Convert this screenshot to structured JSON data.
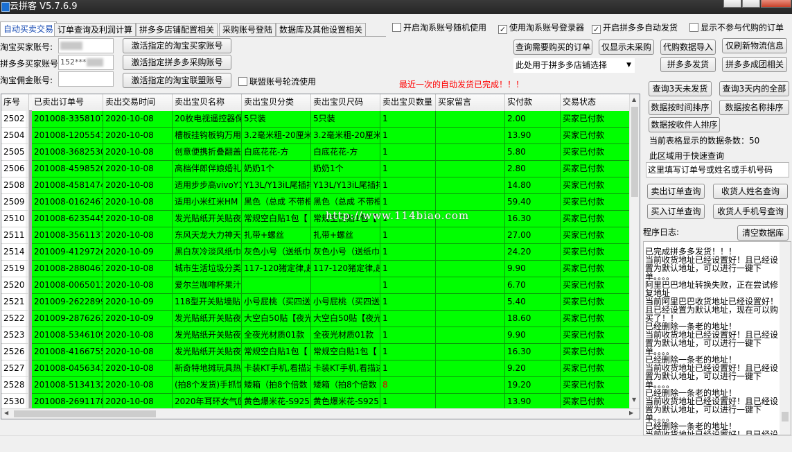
{
  "window": {
    "title": "云拼客 V5.7.6.9"
  },
  "tabs": [
    {
      "label": "自动买卖交易",
      "active": true
    },
    {
      "label": "订单查询及利润计算"
    },
    {
      "label": "拼多多店铺配置相关"
    },
    {
      "label": "采购账号登陆"
    },
    {
      "label": "数据库及其他设置相关"
    }
  ],
  "top_checkboxes": [
    {
      "label": "开启淘系账号随机使用",
      "checked": false
    },
    {
      "label": "使用淘系账号登录器",
      "checked": true
    },
    {
      "label": "开启拼多多自动发货",
      "checked": true
    },
    {
      "label": "显示不参与代购的订单",
      "checked": false
    }
  ],
  "accounts": {
    "taobao_buyer_label": "淘宝买家账号:",
    "pdd_buyer_label": "拼多多买家账号:",
    "taobao_commission_label": "淘宝佣金账号:",
    "pdd_buyer_value": "152***",
    "activate_taobao": "激活指定的淘宝买家账号",
    "activate_pdd": "激活指定拼多多采购账号",
    "activate_alliance": "激活指定的淘宝联盟账号",
    "alliance_rotate": "联盟账号轮流使用"
  },
  "actions": {
    "query_to_buy": "查询需要购买的订单",
    "only_not_bought": "仅显示未采购",
    "import_proxy": "代购数据导入",
    "refresh_logistics": "仅刷新物流信息",
    "store_select": "此处用于拼多多店铺选择",
    "pdd_ship": "拼多多发货",
    "pdd_group": "拼多多成团相关",
    "last_status": "最近一次的自动发货已完成！！！"
  },
  "grid": {
    "columns": [
      "序号",
      "已卖出订单号",
      "卖出交易时间",
      "卖出宝贝名称",
      "卖出宝贝分类",
      "卖出宝贝尺码",
      "卖出宝贝数量",
      "买家留言",
      "实付款",
      "交易状态"
    ],
    "rows": [
      [
        "2502",
        "201008-3358107",
        "2020-10-08",
        "20枚电视遥控器保",
        "5只装",
        "5只装",
        "1",
        "",
        "2.00",
        "买家已付款"
      ],
      [
        "2504",
        "201008-1205541",
        "2020-10-08",
        "槽板挂钩板钩万用",
        "3.2毫米粗-20厘米",
        "3.2毫米粗-20厘米",
        "1",
        "",
        "13.90",
        "买家已付款"
      ],
      [
        "2505",
        "201008-3682530",
        "2020-10-08",
        "创意便携折叠翻盖",
        "白底花花-方",
        "白底花花-方",
        "1",
        "",
        "5.80",
        "买家已付款"
      ],
      [
        "2506",
        "201008-4598520",
        "2020-10-08",
        "高档伴郎伴娘婚礼",
        "奶奶1个",
        "奶奶1个",
        "1",
        "",
        "2.80",
        "买家已付款"
      ],
      [
        "2508",
        "201008-4581474",
        "2020-10-08",
        "适用步步高vivoY1",
        "Y13L/Y13iL尾插排",
        "Y13L/Y13iL尾插排",
        "1",
        "",
        "14.80",
        "买家已付款"
      ],
      [
        "2509",
        "201008-0162467",
        "2020-10-08",
        "适用小米红米HM",
        "黑色（总成 不带框",
        "黑色（总成 不带框",
        "1",
        "",
        "59.40",
        "买家已付款"
      ],
      [
        "2510",
        "201008-6235445",
        "2020-10-08",
        "发光贴纸开关贴夜",
        "常规空白贴1包【",
        "常规空白贴1包【",
        "1",
        "",
        "16.30",
        "买家已付款"
      ],
      [
        "2511",
        "201008-3561137",
        "2020-10-08",
        "东风天龙大力神天",
        "扎带+螺丝",
        "扎带+螺丝",
        "1",
        "",
        "27.00",
        "买家已付款"
      ],
      [
        "2514",
        "201009-4129726",
        "2020-10-09",
        "黑白灰冷淡风纸巾",
        "灰色小号（送纸巾",
        "灰色小号（送纸巾",
        "1",
        "",
        "24.20",
        "买家已付款"
      ],
      [
        "2519",
        "201008-2880461",
        "2020-10-08",
        "城市生活垃圾分类",
        "117-120猪定律,起",
        "117-120猪定律,起",
        "1",
        "",
        "9.90",
        "买家已付款"
      ],
      [
        "2520",
        "201008-0065013",
        "2020-10-08",
        "爱尔兰咖啡杯果汁",
        "",
        "",
        "1",
        "",
        "6.70",
        "买家已付款"
      ],
      [
        "2521",
        "201009-2622899",
        "2020-10-09",
        "118型开关贴墙贴",
        "小号屁桃（买四送",
        "小号屁桃（买四送",
        "1",
        "",
        "5.40",
        "买家已付款"
      ],
      [
        "2522",
        "201009-2876263",
        "2020-10-09",
        "发光贴纸开关贴夜",
        "大空白50贴【夜光",
        "大空白50贴【夜光",
        "1",
        "",
        "18.60",
        "买家已付款"
      ],
      [
        "2523",
        "201008-5346109",
        "2020-10-08",
        "发光贴纸开关贴夜",
        "全夜光材质01款",
        "全夜光材质01款",
        "1",
        "",
        "9.90",
        "买家已付款"
      ],
      [
        "2526",
        "201008-4166755",
        "2020-10-08",
        "发光贴纸开关贴夜",
        "常规空白贴1包【",
        "常规空白贴1包【",
        "1",
        "",
        "16.30",
        "买家已付款"
      ],
      [
        "2527",
        "201008-0456343",
        "2020-10-08",
        "新奇特地摊玩具热",
        "卡装KT手机,看描述",
        "卡装KT手机,看描述",
        "1",
        "",
        "9.20",
        "买家已付款"
      ],
      [
        "2528",
        "201008-5134132",
        "2020-10-08",
        "(拍8个发货)手抓饼",
        "矮箱（拍8个倍数",
        "矮箱（拍8个倍数",
        "8",
        "",
        "19.20",
        "买家已付款"
      ],
      [
        "2530",
        "201008-2691178",
        "2020-10-08",
        "2020年耳环女气质",
        "黄色爆米花-S925",
        "黄色爆米花-S925",
        "1",
        "",
        "13.90",
        "买家已付款"
      ]
    ],
    "red_qty_row": 16
  },
  "watermark": "http://www.114biao.com",
  "right": {
    "q3_unshipped": "查询3天未发货",
    "q3_all": "查询3天内的全部",
    "sort_time": "数据按时间排序",
    "sort_name": "数据按名称排序",
    "sort_receiver": "数据按收件人排序",
    "count_label": "当前表格显示的数据条数：",
    "count_value": "50",
    "quick_label": "此区域用于快速查询",
    "search_placeholder": "这里填写订单号或姓名或手机号码",
    "sold_order_q": "卖出订单查询",
    "receiver_name_q": "收货人姓名查询",
    "buy_order_q": "买入订单查询",
    "receiver_phone_q": "收货人手机号查询",
    "log_label": "程序日志:",
    "clear_db": "清空数据库",
    "log_lines": [
      "已完成拼多多发货！！！",
      "当前收货地址已经设置好！且已经设置为默认地址，可以进行一键下单。。。。",
      "阿里巴巴地址转换失败，正在尝试修复地址",
      "当前阿里巴巴收货地址已经设置好！且已经设置为默认地址，现在可以购买了！！",
      "已经删除一条老的地址！",
      "当前收货地址已经设置好！且已经设置为默认地址，可以进行一键下单。。。。",
      "已经删除一条老的地址！",
      "当前收货地址已经设置好！且已经设置为默认地址，可以进行一键下单。。。。",
      "已经删除一条老的地址！",
      "当前收货地址已经设置好！且已经设置为默认地址，可以进行一键下单。。。。",
      "已经删除一条老的地址！",
      "当前收货地址已经设置好！且已经设置为默认地址，可以进行一键下单"
    ]
  }
}
